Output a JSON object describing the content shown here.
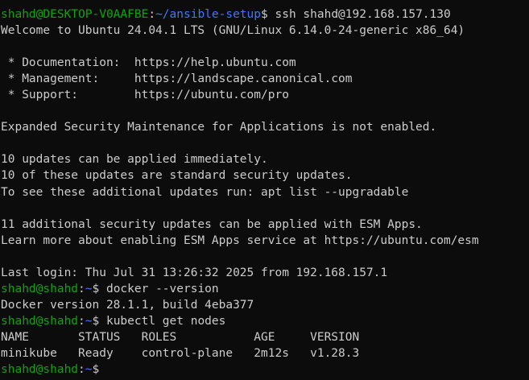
{
  "colors": {
    "background": "#0c0c0c",
    "foreground": "#cccccc",
    "prompt_user": "#13a10e",
    "prompt_path": "#3b78ff"
  },
  "terminal": {
    "lines": [
      {
        "type": "prompt",
        "user": "shahd@DESKTOP-V0AAFBE",
        "sep": ":",
        "path": "~/ansible-setup",
        "sym": "$ ",
        "cmd": "ssh shahd@192.168.157.130"
      },
      {
        "type": "output",
        "text": "Welcome to Ubuntu 24.04.1 LTS (GNU/Linux 6.14.0-24-generic x86_64)"
      },
      {
        "type": "output",
        "text": ""
      },
      {
        "type": "output",
        "text": " * Documentation:  https://help.ubuntu.com"
      },
      {
        "type": "output",
        "text": " * Management:     https://landscape.canonical.com"
      },
      {
        "type": "output",
        "text": " * Support:        https://ubuntu.com/pro"
      },
      {
        "type": "output",
        "text": ""
      },
      {
        "type": "output",
        "text": "Expanded Security Maintenance for Applications is not enabled."
      },
      {
        "type": "output",
        "text": ""
      },
      {
        "type": "output",
        "text": "10 updates can be applied immediately."
      },
      {
        "type": "output",
        "text": "10 of these updates are standard security updates."
      },
      {
        "type": "output",
        "text": "To see these additional updates run: apt list --upgradable"
      },
      {
        "type": "output",
        "text": ""
      },
      {
        "type": "output",
        "text": "11 additional security updates can be applied with ESM Apps."
      },
      {
        "type": "output",
        "text": "Learn more about enabling ESM Apps service at https://ubuntu.com/esm"
      },
      {
        "type": "output",
        "text": ""
      },
      {
        "type": "output",
        "text": "Last login: Thu Jul 31 13:26:32 2025 from 192.168.157.1"
      },
      {
        "type": "prompt",
        "user": "shahd@shahd",
        "sep": ":",
        "path": "~",
        "sym": "$ ",
        "cmd": "docker --version"
      },
      {
        "type": "output",
        "text": "Docker version 28.1.1, build 4eba377"
      },
      {
        "type": "prompt",
        "user": "shahd@shahd",
        "sep": ":",
        "path": "~",
        "sym": "$ ",
        "cmd": "kubectl get nodes"
      },
      {
        "type": "output",
        "text": "NAME       STATUS   ROLES           AGE     VERSION"
      },
      {
        "type": "output",
        "text": "minikube   Ready    control-plane   2m12s   v1.28.3"
      },
      {
        "type": "prompt",
        "user": "shahd@shahd",
        "sep": ":",
        "path": "~",
        "sym": "$",
        "cmd": ""
      }
    ]
  }
}
